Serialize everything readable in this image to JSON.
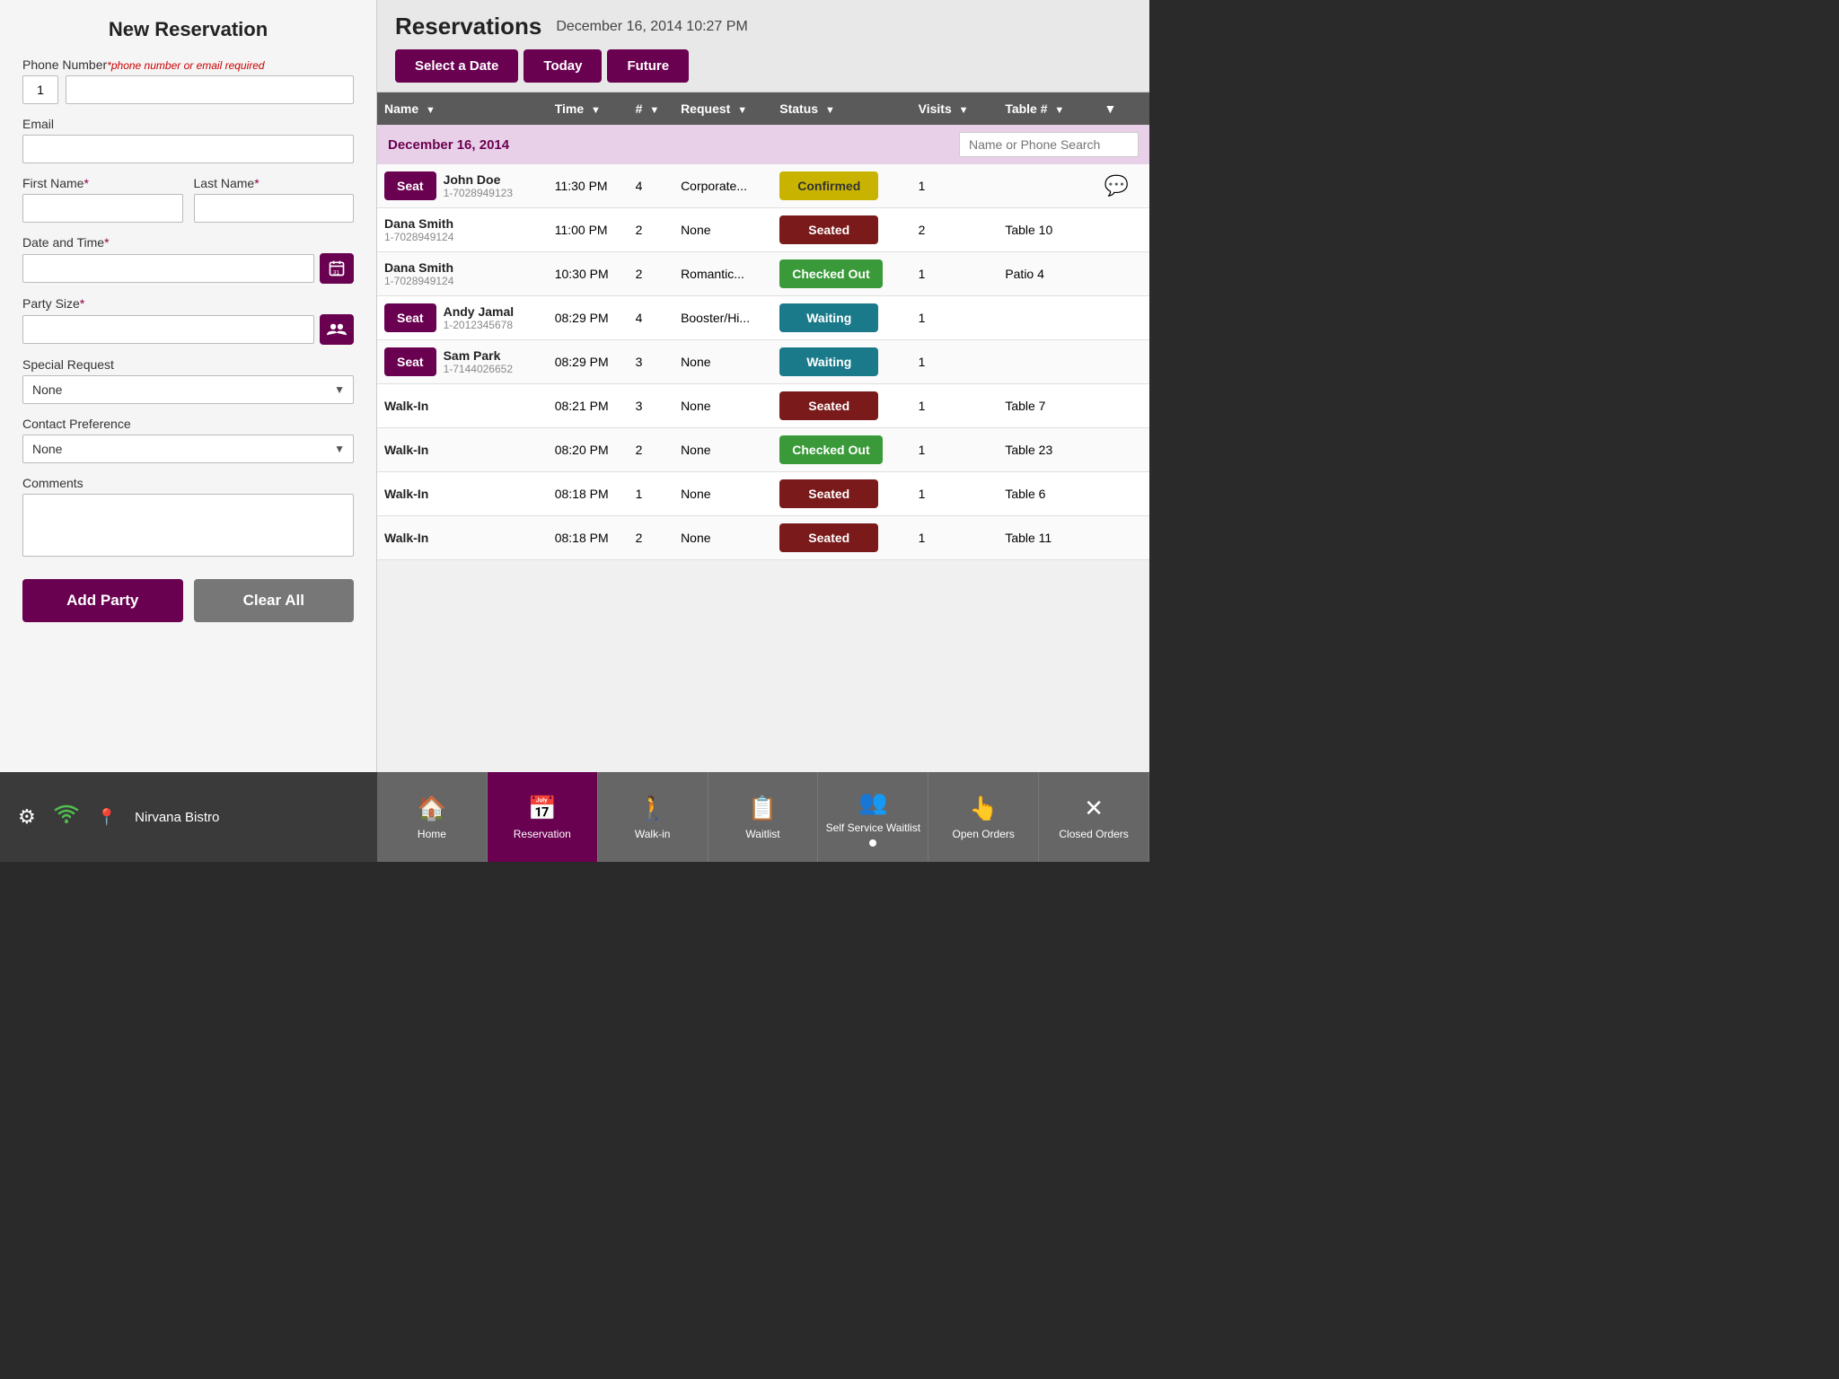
{
  "left_panel": {
    "title": "New Reservation",
    "phone_label": "Phone Number",
    "phone_hint": "*phone number or email required",
    "phone_prefix": "1",
    "email_label": "Email",
    "first_name_label": "First Name",
    "last_name_label": "Last Name",
    "datetime_label": "Date and Time",
    "party_size_label": "Party Size",
    "special_request_label": "Special Request",
    "special_request_default": "None",
    "contact_preference_label": "Contact Preference",
    "contact_preference_default": "None",
    "comments_label": "Comments",
    "add_button": "Add Party",
    "clear_button": "Clear All"
  },
  "right_panel": {
    "title": "Reservations",
    "date_time": "December 16, 2014 10:27 PM",
    "select_date_btn": "Select a Date",
    "today_btn": "Today",
    "future_btn": "Future",
    "search_placeholder": "Name or Phone Search",
    "columns": {
      "name": "Name",
      "time": "Time",
      "party": "#",
      "request": "Request",
      "status": "Status",
      "visits": "Visits",
      "table": "Table #"
    },
    "section_date": "December 16, 2014",
    "reservations": [
      {
        "name": "John Doe",
        "phone": "1-7028949123",
        "has_seat_btn": true,
        "time": "11:30 PM",
        "party": "4",
        "request": "Corporate...",
        "status": "Confirmed",
        "status_class": "status-confirmed",
        "visits": "1",
        "table": "",
        "has_comment": true
      },
      {
        "name": "Dana Smith",
        "phone": "1-7028949124",
        "has_seat_btn": false,
        "time": "11:00 PM",
        "party": "2",
        "request": "None",
        "status": "Seated",
        "status_class": "status-seated",
        "visits": "2",
        "table": "Table 10",
        "has_comment": false
      },
      {
        "name": "Dana Smith",
        "phone": "1-7028949124",
        "has_seat_btn": false,
        "time": "10:30 PM",
        "party": "2",
        "request": "Romantic...",
        "status": "Checked Out",
        "status_class": "status-checked-out",
        "visits": "1",
        "table": "Patio 4",
        "has_comment": false
      },
      {
        "name": "Andy Jamal",
        "phone": "1-2012345678",
        "has_seat_btn": true,
        "time": "08:29 PM",
        "party": "4",
        "request": "Booster/Hi...",
        "status": "Waiting",
        "status_class": "status-waiting",
        "visits": "1",
        "table": "",
        "has_comment": false
      },
      {
        "name": "Sam Park",
        "phone": "1-7144026652",
        "has_seat_btn": true,
        "time": "08:29 PM",
        "party": "3",
        "request": "None",
        "status": "Waiting",
        "status_class": "status-waiting",
        "visits": "1",
        "table": "",
        "has_comment": false
      },
      {
        "name": "Walk-In",
        "phone": "",
        "has_seat_btn": false,
        "time": "08:21 PM",
        "party": "3",
        "request": "None",
        "status": "Seated",
        "status_class": "status-seated",
        "visits": "1",
        "table": "Table 7",
        "has_comment": false
      },
      {
        "name": "Walk-In",
        "phone": "",
        "has_seat_btn": false,
        "time": "08:20 PM",
        "party": "2",
        "request": "None",
        "status": "Checked Out",
        "status_class": "status-checked-out",
        "visits": "1",
        "table": "Table 23",
        "has_comment": false
      },
      {
        "name": "Walk-In",
        "phone": "",
        "has_seat_btn": false,
        "time": "08:18 PM",
        "party": "1",
        "request": "None",
        "status": "Seated",
        "status_class": "status-seated",
        "visits": "1",
        "table": "Table 6",
        "has_comment": false
      },
      {
        "name": "Walk-In",
        "phone": "",
        "has_seat_btn": false,
        "time": "08:18 PM",
        "party": "2",
        "request": "None",
        "status": "Seated",
        "status_class": "status-seated",
        "visits": "1",
        "table": "Table 11",
        "has_comment": false
      }
    ]
  },
  "bottom_nav": {
    "restaurant_name": "Nirvana Bistro",
    "tabs": [
      {
        "id": "home",
        "label": "Home",
        "icon": "🏠",
        "active": false
      },
      {
        "id": "reservation",
        "label": "Reservation",
        "icon": "📅",
        "active": true
      },
      {
        "id": "walkin",
        "label": "Walk-in",
        "icon": "🚶",
        "active": false
      },
      {
        "id": "waitlist",
        "label": "Waitlist",
        "icon": "📋",
        "active": false
      },
      {
        "id": "self-service",
        "label": "Self Service Waitlist",
        "icon": "👥",
        "active": false,
        "has_dot": true
      },
      {
        "id": "open-orders",
        "label": "Open Orders",
        "icon": "👆",
        "active": false
      },
      {
        "id": "closed-orders",
        "label": "Closed Orders",
        "icon": "✕",
        "active": false
      }
    ]
  }
}
